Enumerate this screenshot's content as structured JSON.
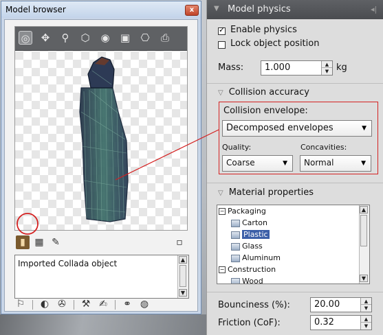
{
  "browser": {
    "title": "Model browser",
    "close_glyph": "x",
    "viewport_tools": [
      {
        "icon": "orbit-icon",
        "glyph": "◎"
      },
      {
        "icon": "pan-icon",
        "glyph": "✥"
      },
      {
        "icon": "zoom-icon",
        "glyph": "⚲"
      },
      {
        "icon": "box-view-icon",
        "glyph": "⬡"
      },
      {
        "icon": "sphere-view-icon",
        "glyph": "◉"
      },
      {
        "icon": "frame-icon",
        "glyph": "▣"
      },
      {
        "icon": "render-mode-icon",
        "glyph": "⎔"
      },
      {
        "icon": "camera-icon",
        "glyph": "⎙"
      }
    ],
    "bottom_tools": [
      {
        "icon": "model-icon",
        "glyph": "▮"
      },
      {
        "icon": "grid-model-icon",
        "glyph": "▦"
      },
      {
        "icon": "edit-icon",
        "glyph": "✎"
      },
      {
        "icon": "maximize-icon",
        "glyph": "▫"
      }
    ],
    "description": "Imported Collada object",
    "status_icons": [
      {
        "icon": "flag-icon",
        "glyph": "⚐"
      },
      {
        "icon": "contrast-icon",
        "glyph": "◐"
      },
      {
        "icon": "physics-icon",
        "glyph": "✇"
      },
      {
        "icon": "tools-icon",
        "glyph": "⚒"
      },
      {
        "icon": "edit-material-icon",
        "glyph": "✍"
      },
      {
        "icon": "link-icon",
        "glyph": "⚭"
      },
      {
        "icon": "globe-icon",
        "glyph": "◍"
      }
    ]
  },
  "physics": {
    "header": "Model physics",
    "header_right_glyph": "◂|",
    "enable_physics": {
      "label": "Enable physics",
      "checked": true
    },
    "lock_position": {
      "label": "Lock object position",
      "checked": false
    },
    "mass": {
      "label": "Mass:",
      "value": "1.000",
      "unit": "kg"
    },
    "collision": {
      "header": "Collision accuracy",
      "envelope_label": "Collision envelope:",
      "envelope_value": "Decomposed envelopes",
      "quality_label": "Quality:",
      "quality_value": "Coarse",
      "concavities_label": "Concavities:",
      "concavities_value": "Normal"
    },
    "material": {
      "header": "Material properties",
      "tree": [
        {
          "label": "Packaging",
          "type": "group",
          "expander": "−"
        },
        {
          "label": "Carton",
          "type": "item"
        },
        {
          "label": "Plastic",
          "type": "item",
          "selected": true
        },
        {
          "label": "Glass",
          "type": "item"
        },
        {
          "label": "Aluminum",
          "type": "item"
        },
        {
          "label": "Construction",
          "type": "group",
          "expander": "−"
        },
        {
          "label": "Wood",
          "type": "item"
        }
      ]
    },
    "bounciness": {
      "label": "Bounciness (%):",
      "value": "20.00"
    },
    "friction": {
      "label": "Friction (CoF):",
      "value": "0.32"
    }
  },
  "colors": {
    "annotation_red": "#d42020",
    "selection_blue": "#3c5fa8",
    "model_teal": "#3f6f6a"
  }
}
